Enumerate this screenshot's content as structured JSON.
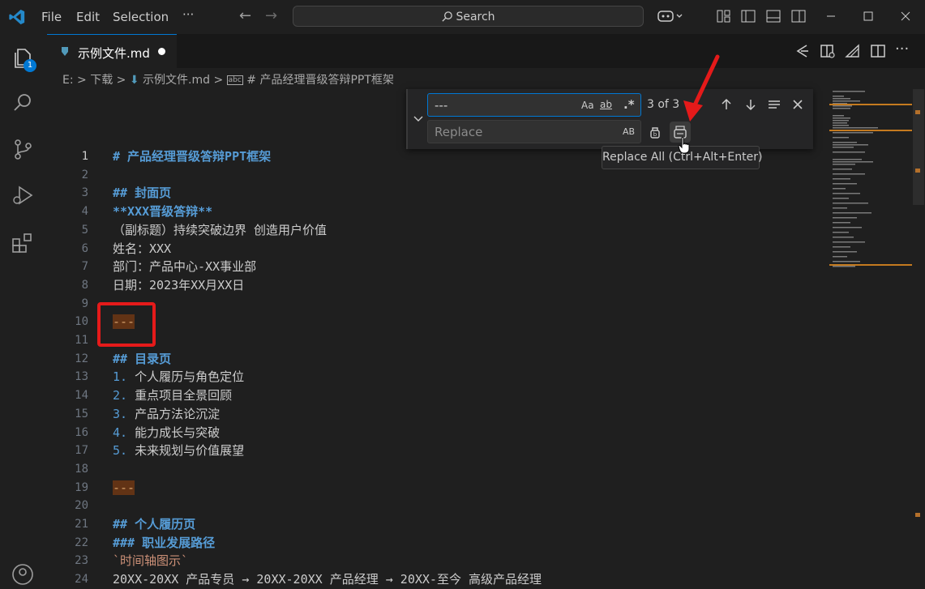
{
  "menu": {
    "file": "File",
    "edit": "Edit",
    "selection": "Selection",
    "more": "···"
  },
  "search": {
    "label": "Search"
  },
  "tab": {
    "label": "示例文件.md"
  },
  "explorer_badge": "1",
  "breadcrumb": {
    "drive": "E:",
    "sep1": ">",
    "folder": "下载",
    "sep2": ">",
    "file": "示例文件.md",
    "sep3": ">",
    "symbol": "# 产品经理晋级答辩PPT框架"
  },
  "find": {
    "query": "---",
    "replace_placeholder": "Replace",
    "match_case": "Aa",
    "whole_word": "ab",
    "regex": ".*",
    "preserve_case": "AB",
    "result": "3 of 3",
    "tooltip": "Replace All (Ctrl+Alt+Enter)"
  },
  "lines": [
    {
      "n": "1",
      "t": "# 产品经理晋级答辩PPT框架"
    },
    {
      "n": "2",
      "t": ""
    },
    {
      "n": "3",
      "t": "## 封面页"
    },
    {
      "n": "4",
      "t": "**XXX晋级答辩**"
    },
    {
      "n": "5",
      "t": "（副标题）持续突破边界 创造用户价值"
    },
    {
      "n": "6",
      "t": "姓名：XXX"
    },
    {
      "n": "7",
      "t": "部门：产品中心-XX事业部"
    },
    {
      "n": "8",
      "t": "日期：2023年XX月XX日"
    },
    {
      "n": "9",
      "t": ""
    },
    {
      "n": "10",
      "t": "---"
    },
    {
      "n": "11",
      "t": ""
    },
    {
      "n": "12",
      "t": "## 目录页"
    },
    {
      "n": "13",
      "num": "1.",
      "t": " 个人履历与角色定位"
    },
    {
      "n": "14",
      "num": "2.",
      "t": " 重点项目全景回顾"
    },
    {
      "n": "15",
      "num": "3.",
      "t": " 产品方法论沉淀"
    },
    {
      "n": "16",
      "num": "4.",
      "t": " 能力成长与突破"
    },
    {
      "n": "17",
      "num": "5.",
      "t": " 未来规划与价值展望"
    },
    {
      "n": "18",
      "t": ""
    },
    {
      "n": "19",
      "t": "---"
    },
    {
      "n": "20",
      "t": ""
    },
    {
      "n": "21",
      "t": "## 个人履历页"
    },
    {
      "n": "22",
      "t": "### 职业发展路径"
    },
    {
      "n": "23",
      "t": "`时间轴图示`"
    },
    {
      "n": "24",
      "t": "20XX-20XX 产品专员 → 20XX-20XX 产品经理 → 20XX-至今 高级产品经理"
    }
  ],
  "colors": {
    "accent": "#0078d4",
    "heading": "#569cd6",
    "match": "#623315",
    "annotation": "#e51a1a"
  }
}
